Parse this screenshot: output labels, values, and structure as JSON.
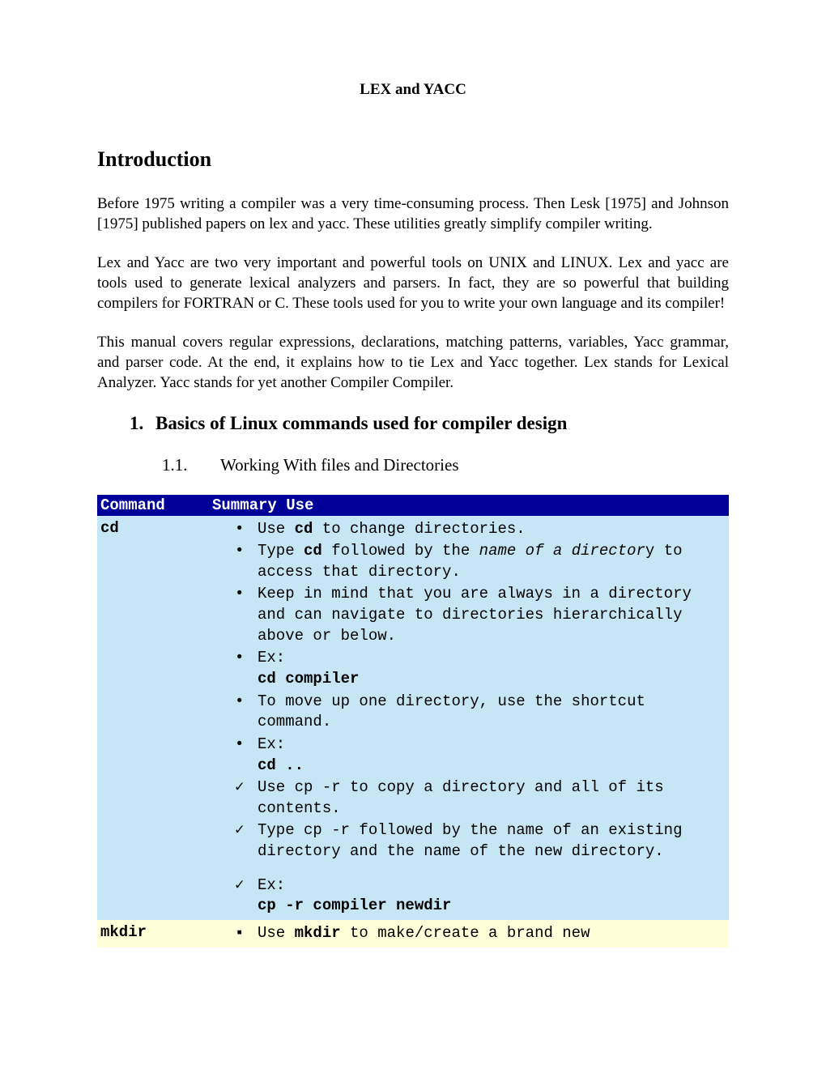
{
  "title": "LEX and YACC",
  "intro_heading": "Introduction",
  "para1": "Before 1975 writing a compiler was a very time-consuming process. Then Lesk [1975] and Johnson [1975] published papers on lex and yacc. These utilities greatly simplify compiler writing.",
  "para2": "Lex and Yacc are two very important and powerful tools on UNIX and LINUX. Lex and yacc are tools used to generate lexical analyzers and parsers. In fact, they are so powerful that building compilers for FORTRAN or C. These tools used for you to write your own language and its compiler!",
  "para3": "This manual covers regular expressions, declarations, matching patterns, variables, Yacc grammar, and parser code. At the end, it explains how to tie Lex and Yacc together. Lex stands for Lexical Analyzer. Yacc stands for yet another Compiler Compiler.",
  "section1": {
    "num": "1.",
    "title": "Basics of Linux commands used for compiler design",
    "sub1_num": "1.1.",
    "sub1_title": "Working With files and Directories"
  },
  "table": {
    "headers": {
      "col1": "Command",
      "col2": "Summary Use"
    },
    "cd": {
      "name": "cd",
      "items": {
        "i1_pre": "Use ",
        "i1_b": "cd",
        "i1_post": " to change directories.",
        "i2_pre": "Type ",
        "i2_b": "cd",
        "i2_mid": " followed by the ",
        "i2_i": "name of a director",
        "i2_post": "y to access that directory.",
        "i3": "Keep in mind that you are always in a directory and can navigate to directories hierarchically above or below.",
        "i4_label": "Ex:",
        "i4_code": "cd compiler",
        "i5": "To move up one directory, use the shortcut command.",
        "i6_label": "Ex:",
        "i6_code": "cd ..",
        "i7": "Use cp -r to copy a directory and all of its contents.",
        "i8": "Type cp -r followed by the name of an existing directory and the name of the new directory.",
        "i9_label": "Ex:",
        "i9_code": "cp -r compiler newdir"
      }
    },
    "mkdir": {
      "name": "mkdir",
      "i1_pre": "Use ",
      "i1_b": "mkdir",
      "i1_post": " to make/create a brand new"
    }
  },
  "markers": {
    "bullet": "•",
    "check": "✓",
    "square": "▪"
  }
}
